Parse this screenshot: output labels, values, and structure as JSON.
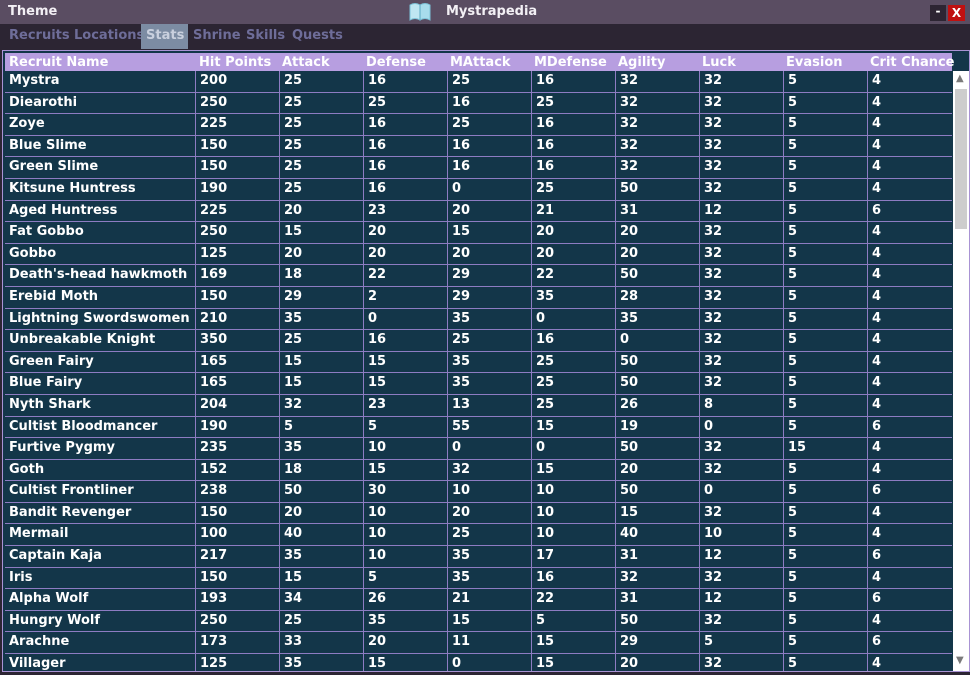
{
  "titlebar": {
    "theme_label": "Theme",
    "app_title": "Mystrapedia",
    "icon": "book-icon",
    "minimize_label": "-",
    "close_label": "X"
  },
  "tabs": [
    {
      "label": "Recruits",
      "active": false
    },
    {
      "label": "Locations",
      "active": false
    },
    {
      "label": "Stats",
      "active": true
    },
    {
      "label": "Shrine",
      "active": false
    },
    {
      "label": "Skills",
      "active": false
    },
    {
      "label": "Quests",
      "active": false
    }
  ],
  "table": {
    "columns": [
      "Recruit Name",
      "Hit Points",
      "Attack",
      "Defense",
      "MAttack",
      "MDefense",
      "Agility",
      "Luck",
      "Evasion",
      "Crit Chance"
    ],
    "rows": [
      [
        "Mystra",
        "200",
        "25",
        "16",
        "25",
        "16",
        "32",
        "32",
        "5",
        "4"
      ],
      [
        "Diearothi",
        "250",
        "25",
        "25",
        "16",
        "25",
        "32",
        "32",
        "5",
        "4"
      ],
      [
        "Zoye",
        "225",
        "25",
        "16",
        "25",
        "16",
        "32",
        "32",
        "5",
        "4"
      ],
      [
        "Blue Slime",
        "150",
        "25",
        "16",
        "16",
        "16",
        "32",
        "32",
        "5",
        "4"
      ],
      [
        "Green Slime",
        "150",
        "25",
        "16",
        "16",
        "16",
        "32",
        "32",
        "5",
        "4"
      ],
      [
        "Kitsune Huntress",
        "190",
        "25",
        "16",
        "0",
        "25",
        "50",
        "32",
        "5",
        "4"
      ],
      [
        "Aged Huntress",
        "225",
        "20",
        "23",
        "20",
        "21",
        "31",
        "12",
        "5",
        "6"
      ],
      [
        "Fat Gobbo",
        "250",
        "15",
        "20",
        "15",
        "20",
        "20",
        "32",
        "5",
        "4"
      ],
      [
        "Gobbo",
        "125",
        "20",
        "20",
        "20",
        "20",
        "20",
        "32",
        "5",
        "4"
      ],
      [
        "Death's-head hawkmoth",
        "169",
        "18",
        "22",
        "29",
        "22",
        "50",
        "32",
        "5",
        "4"
      ],
      [
        "Erebid Moth",
        "150",
        "29",
        "2",
        "29",
        "35",
        "28",
        "32",
        "5",
        "4"
      ],
      [
        "Lightning Swordswomen",
        "210",
        "35",
        "0",
        "35",
        "0",
        "35",
        "32",
        "5",
        "4"
      ],
      [
        "Unbreakable Knight",
        "350",
        "25",
        "16",
        "25",
        "16",
        "0",
        "32",
        "5",
        "4"
      ],
      [
        "Green Fairy",
        "165",
        "15",
        "15",
        "35",
        "25",
        "50",
        "32",
        "5",
        "4"
      ],
      [
        "Blue Fairy",
        "165",
        "15",
        "15",
        "35",
        "25",
        "50",
        "32",
        "5",
        "4"
      ],
      [
        "Nyth Shark",
        "204",
        "32",
        "23",
        "13",
        "25",
        "26",
        "8",
        "5",
        "4"
      ],
      [
        "Cultist Bloodmancer",
        "190",
        "5",
        "5",
        "55",
        "15",
        "19",
        "0",
        "5",
        "6"
      ],
      [
        "Furtive Pygmy",
        "235",
        "35",
        "10",
        "0",
        "0",
        "50",
        "32",
        "15",
        "4"
      ],
      [
        "Goth",
        "152",
        "18",
        "15",
        "32",
        "15",
        "20",
        "32",
        "5",
        "4"
      ],
      [
        "Cultist Frontliner",
        "238",
        "50",
        "30",
        "10",
        "10",
        "50",
        "0",
        "5",
        "6"
      ],
      [
        "Bandit Revenger",
        "150",
        "20",
        "10",
        "20",
        "10",
        "15",
        "32",
        "5",
        "4"
      ],
      [
        "Mermail",
        "100",
        "40",
        "10",
        "25",
        "10",
        "40",
        "10",
        "5",
        "4"
      ],
      [
        "Captain Kaja",
        "217",
        "35",
        "10",
        "35",
        "17",
        "31",
        "12",
        "5",
        "6"
      ],
      [
        "Iris",
        "150",
        "15",
        "5",
        "35",
        "16",
        "32",
        "32",
        "5",
        "4"
      ],
      [
        "Alpha Wolf",
        "193",
        "34",
        "26",
        "21",
        "22",
        "31",
        "12",
        "5",
        "6"
      ],
      [
        "Hungry Wolf",
        "250",
        "25",
        "35",
        "15",
        "5",
        "50",
        "32",
        "5",
        "4"
      ],
      [
        "Arachne",
        "173",
        "33",
        "20",
        "11",
        "15",
        "29",
        "5",
        "5",
        "6"
      ],
      [
        "Villager",
        "125",
        "35",
        "15",
        "0",
        "15",
        "20",
        "32",
        "5",
        "4"
      ]
    ]
  },
  "scrollbar": {
    "up_icon": "chevron-up-icon",
    "down_icon": "chevron-down-icon"
  }
}
